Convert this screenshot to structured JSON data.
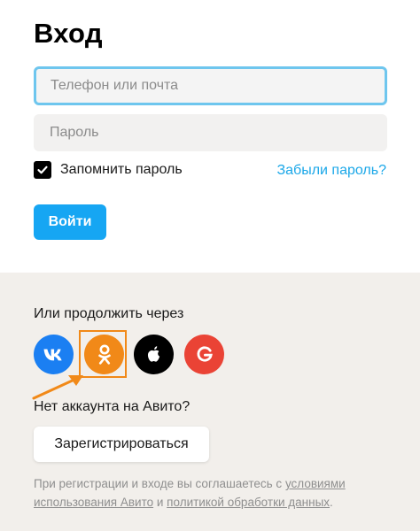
{
  "title": "Вход",
  "phone_field": {
    "placeholder": "Телефон или почта"
  },
  "password_field": {
    "placeholder": "Пароль"
  },
  "remember": {
    "label": "Запомнить пароль",
    "checked": true
  },
  "forgot_link": "Забыли пароль?",
  "login_button": "Войти",
  "continue_label": "Или продолжить через",
  "social": [
    {
      "name": "vk",
      "icon": "vk-icon",
      "color": "#1b7ff2"
    },
    {
      "name": "odnoklassniki",
      "icon": "odnoklassniki-icon",
      "color": "#f18918"
    },
    {
      "name": "apple",
      "icon": "apple-icon",
      "color": "#000000"
    },
    {
      "name": "google",
      "icon": "google-icon",
      "color": "#ea4335"
    }
  ],
  "no_account": "Нет аккаунта на Авито?",
  "register_button": "Зарегистрироваться",
  "terms": {
    "prefix": "При регистрации и входе вы соглашаетесь с ",
    "link1": "условиями использования Авито",
    "middle": " и ",
    "link2": "политикой обработки данных",
    "suffix": "."
  },
  "colors": {
    "accent": "#16a6f3",
    "link": "#1aa7e8",
    "highlight": "#f18918",
    "lower_background": "#f2efeb"
  }
}
